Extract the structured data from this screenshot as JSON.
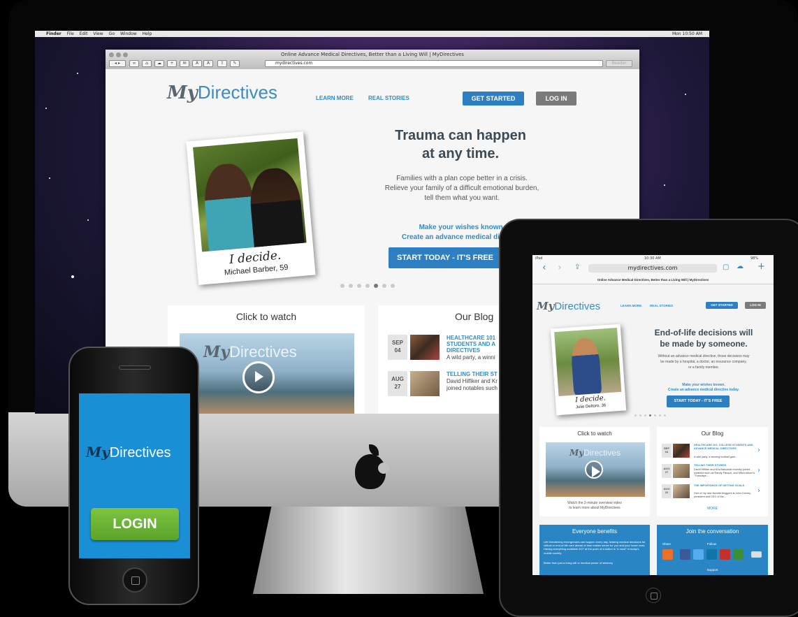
{
  "desktop": {
    "menubar": {
      "items": [
        "Finder",
        "File",
        "Edit",
        "View",
        "Go",
        "Window",
        "Help"
      ],
      "clock": "Mon 10:50 AM"
    },
    "browser": {
      "window_title": "Online Advance Medical Directives, Better than a Living Will | MyDirectives",
      "url": "mydirectives.com",
      "reader": "Reader"
    },
    "site": {
      "logo_script": "My",
      "logo_word": "Directives",
      "nav": [
        "LEARN MORE",
        "REAL STORIES"
      ],
      "get_started": "GET STARTED",
      "log_in": "LOG IN",
      "headline_1": "Trauma can happen",
      "headline_2": "at any time.",
      "sub_1": "Families with a plan cope better in a crisis.",
      "sub_2": "Relieve your family of a difficult emotional burden,",
      "sub_3": "tell them what you want.",
      "cta_1": "Make your wishes known.",
      "cta_2": "Create an advance medical directive",
      "start_button": "START TODAY - IT'S FREE",
      "polaroid_script": "I decide.",
      "polaroid_name": "Michael Barber, 59",
      "video_title": "Click to watch",
      "blog_title": "Our Blog",
      "blog_items": [
        {
          "month": "SEP",
          "day": "04",
          "title": "HEALTHCARE 101 STUDENTS AND A DIRECTIVES",
          "text": "A wild party, a winni"
        },
        {
          "month": "AUG",
          "day": "27",
          "title": "TELLING THEIR ST",
          "text": "David Hilfiker and Kr joined notables such"
        }
      ]
    }
  },
  "phone": {
    "logo_script": "My",
    "logo_word": "Directives",
    "login": "LOGIN"
  },
  "tablet": {
    "status_left": "iPad",
    "status_time": "10:30 AM",
    "status_battery": "98%",
    "url": "mydirectives.com",
    "page_title": "Online Advance Medical Directives, Better than a Living Will | MyDirectives",
    "logo_script": "My",
    "logo_word": "Directives",
    "nav": [
      "LEARN MORE",
      "REAL STORIES"
    ],
    "get_started": "GET STARTED",
    "log_in": "LOG IN",
    "headline_1": "End-of-life decisions will",
    "headline_2": "be made by someone.",
    "sub_1": "Without an advance medical directive, those decisions may",
    "sub_2": "be made by a hospital, a doctor, an insurance company,",
    "sub_3": "or a family member.",
    "cta_1": "Make your wishes known.",
    "cta_2": "Create an advance medical directive today.",
    "start_button": "START TODAY - IT'S FREE",
    "polaroid_script": "I decide.",
    "polaroid_name": "Julie Deltoro, 36",
    "video_title": "Click to watch",
    "video_caption_1": "Watch the 2-minute overview video",
    "video_caption_2": "to learn more about MyDirectives",
    "blog_title": "Our Blog",
    "blog_items": [
      {
        "month": "SEP",
        "day": "04",
        "title": "HEALTHCARE 101: COLLEGE STUDENTS AND ADVANCE MEDICAL DIRECTIVES",
        "text": "A wild party, a winning football gam..."
      },
      {
        "month": "AUG",
        "day": "27",
        "title": "TELLING THEIR STORIES",
        "text": "David Hilfiker and Kris Bakowski recently joined notables such as Randy Pausch, and Mitch Albom's \"Tuesdays..."
      },
      {
        "month": "AUG",
        "day": "22",
        "title": "THE IMPORTANCE OF SETTING GOALS",
        "text": "One of my new favorite bloggers is John Carney, president and CEO of the..."
      }
    ],
    "more": "MORE",
    "benefits_title": "Everyone benefits",
    "benefits_text_1": "Life threatening emergencies can happen every day. Making medical decisions for critical or end-of-life care ahead of time makes sense for you and your loved ones. Having everything available 24/7 at the push of a button is \"a must\" in today's mobile society.",
    "benefits_text_2": "Better than just a living will or medical power of attorney,",
    "join_title": "Join the conversation",
    "share": "Share",
    "follow": "Follow",
    "support": "Support"
  },
  "colors": {
    "brand_blue": "#2f8cc8",
    "button_blue": "#2d7fc1",
    "login_green": "#6cb636",
    "phone_bg": "#1a8fd6"
  }
}
